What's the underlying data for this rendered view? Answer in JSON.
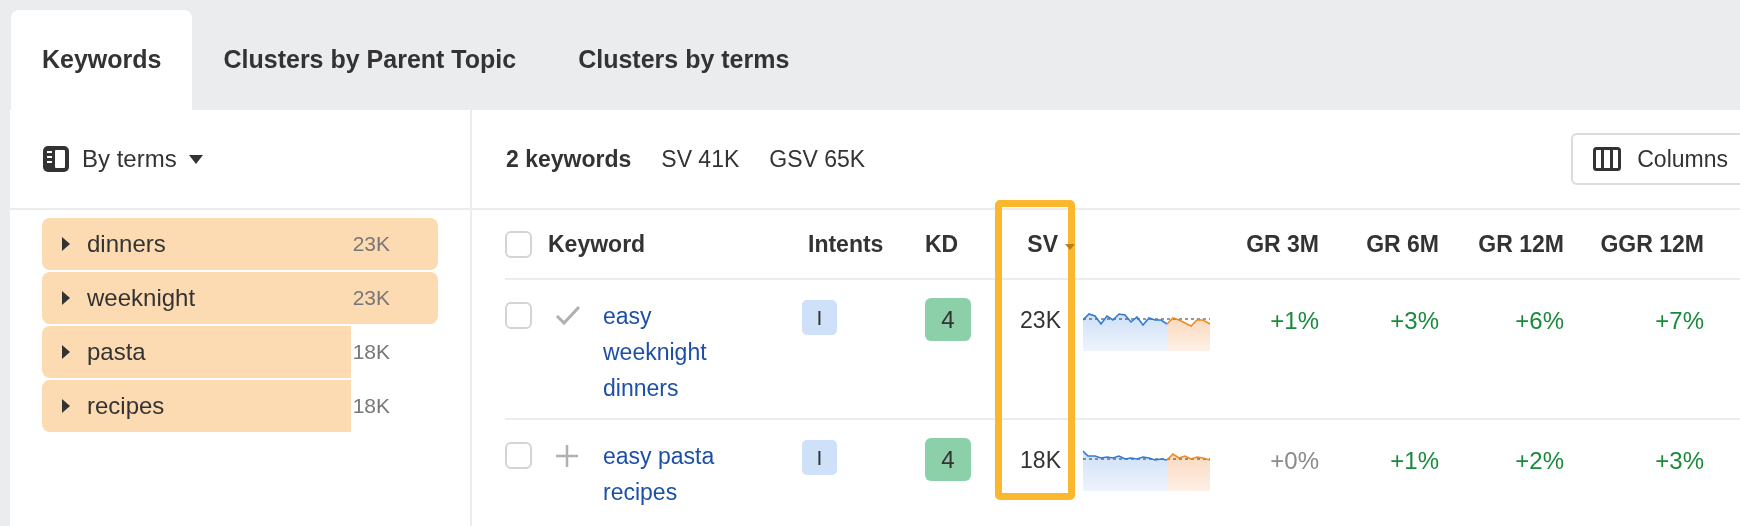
{
  "tabs": [
    {
      "label": "Keywords",
      "selected": true
    },
    {
      "label": "Clusters by Parent Topic",
      "selected": false
    },
    {
      "label": "Clusters by terms",
      "selected": false
    }
  ],
  "sidebar": {
    "grouping": "By terms",
    "items": [
      {
        "label": "dinners",
        "count": "23K",
        "level": 1
      },
      {
        "label": "weeknight",
        "count": "23K",
        "level": 1
      },
      {
        "label": "pasta",
        "count": "18K",
        "level": 0.78
      },
      {
        "label": "recipes",
        "count": "18K",
        "level": 0.78
      }
    ]
  },
  "summary": {
    "keywords": "2 keywords",
    "sv": "SV 41K",
    "gsv": "GSV 65K"
  },
  "columns_button": "Columns",
  "table": {
    "all_checked": false,
    "columns": [
      {
        "label": "Keyword"
      },
      {
        "label": "Intents"
      },
      {
        "label": "KD"
      },
      {
        "label": "SV",
        "sorted": true,
        "highlighted": true
      },
      {
        "label": "GR 3M"
      },
      {
        "label": "GR 6M"
      },
      {
        "label": "GR 12M"
      },
      {
        "label": "GGR 12M"
      }
    ],
    "rows": [
      {
        "checked": false,
        "kind": "check",
        "keyword": "easy weeknight dinners",
        "intent": "I",
        "kd": "4",
        "sv": "23K",
        "growth": [
          {
            "value": "+1%",
            "kind": "positive"
          },
          {
            "value": "+3%",
            "kind": "positive"
          },
          {
            "value": "+6%",
            "kind": "positive"
          },
          {
            "value": "+7%",
            "kind": "positive"
          }
        ]
      },
      {
        "checked": false,
        "kind": "plus",
        "keyword": "easy pasta recipes",
        "intent": "I",
        "kd": "4",
        "sv": "18K",
        "growth": [
          {
            "value": "+0%",
            "kind": "neutral"
          },
          {
            "value": "+1%",
            "kind": "positive"
          },
          {
            "value": "+2%",
            "kind": "positive"
          },
          {
            "value": "+3%",
            "kind": "positive"
          }
        ]
      }
    ]
  }
}
